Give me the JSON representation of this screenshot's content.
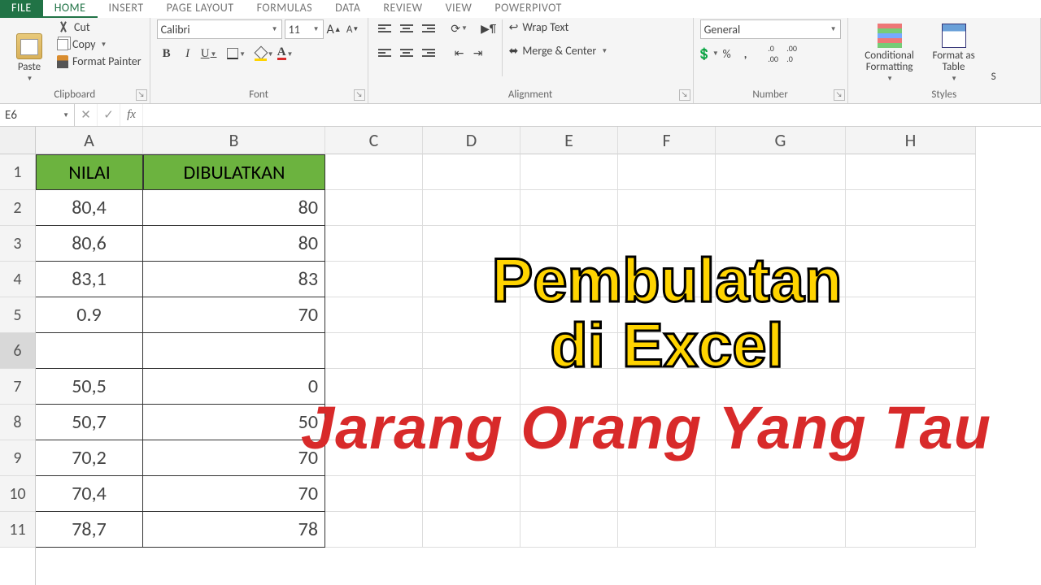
{
  "tabs": {
    "file": "FILE",
    "home": "HOME",
    "insert": "INSERT",
    "pagelayout": "PAGE LAYOUT",
    "formulas": "FORMULAS",
    "data": "DATA",
    "review": "REVIEW",
    "view": "VIEW",
    "powerpivot": "POWERPIVOT"
  },
  "ribbon": {
    "clipboard": {
      "label": "Clipboard",
      "paste": "Paste",
      "cut": "Cut",
      "copy": "Copy",
      "painter": "Format Painter"
    },
    "font": {
      "label": "Font",
      "name": "Calibri",
      "size": "11",
      "bold": "B",
      "italic": "I",
      "underline": "U",
      "fontcolor": "A",
      "grow": "A",
      "shrink": "A"
    },
    "alignment": {
      "label": "Alignment",
      "wrap": "Wrap Text",
      "merge": "Merge & Center"
    },
    "number": {
      "label": "Number",
      "format": "General",
      "percent": "%",
      "comma": ",",
      "incdec": ".0",
      "d1": ".00",
      "d2": ".0"
    },
    "styles": {
      "label": "Styles",
      "cond": "Conditional Formatting",
      "table": "Format as Table",
      "cell": "S"
    }
  },
  "formula_bar": {
    "cell_ref": "E6",
    "fx": "fx",
    "value": ""
  },
  "sheet": {
    "columns": [
      "A",
      "B",
      "C",
      "D",
      "E",
      "F",
      "G",
      "H"
    ],
    "row_numbers": [
      "1",
      "2",
      "3",
      "4",
      "5",
      "6",
      "7",
      "8",
      "9",
      "10",
      "11"
    ],
    "headers": {
      "a": "NILAI",
      "b": "DIBULATKAN"
    },
    "rows": [
      {
        "a": "80,4",
        "b": "80"
      },
      {
        "a": "80,6",
        "b": "80"
      },
      {
        "a": "83,1",
        "b": "83"
      },
      {
        "a": "0.9",
        "b": "70"
      },
      {
        "a": "",
        "b": ""
      },
      {
        "a": "50,5",
        "b": "0"
      },
      {
        "a": "50,7",
        "b": "50"
      },
      {
        "a": "70,2",
        "b": "70"
      },
      {
        "a": "70,4",
        "b": "70"
      },
      {
        "a": "78,7",
        "b": "78"
      }
    ],
    "active_row": 6
  },
  "overlay": {
    "line1a": "Pembulatan",
    "line1b": "di Excel",
    "line2": "Jarang Orang Yang Tau"
  }
}
